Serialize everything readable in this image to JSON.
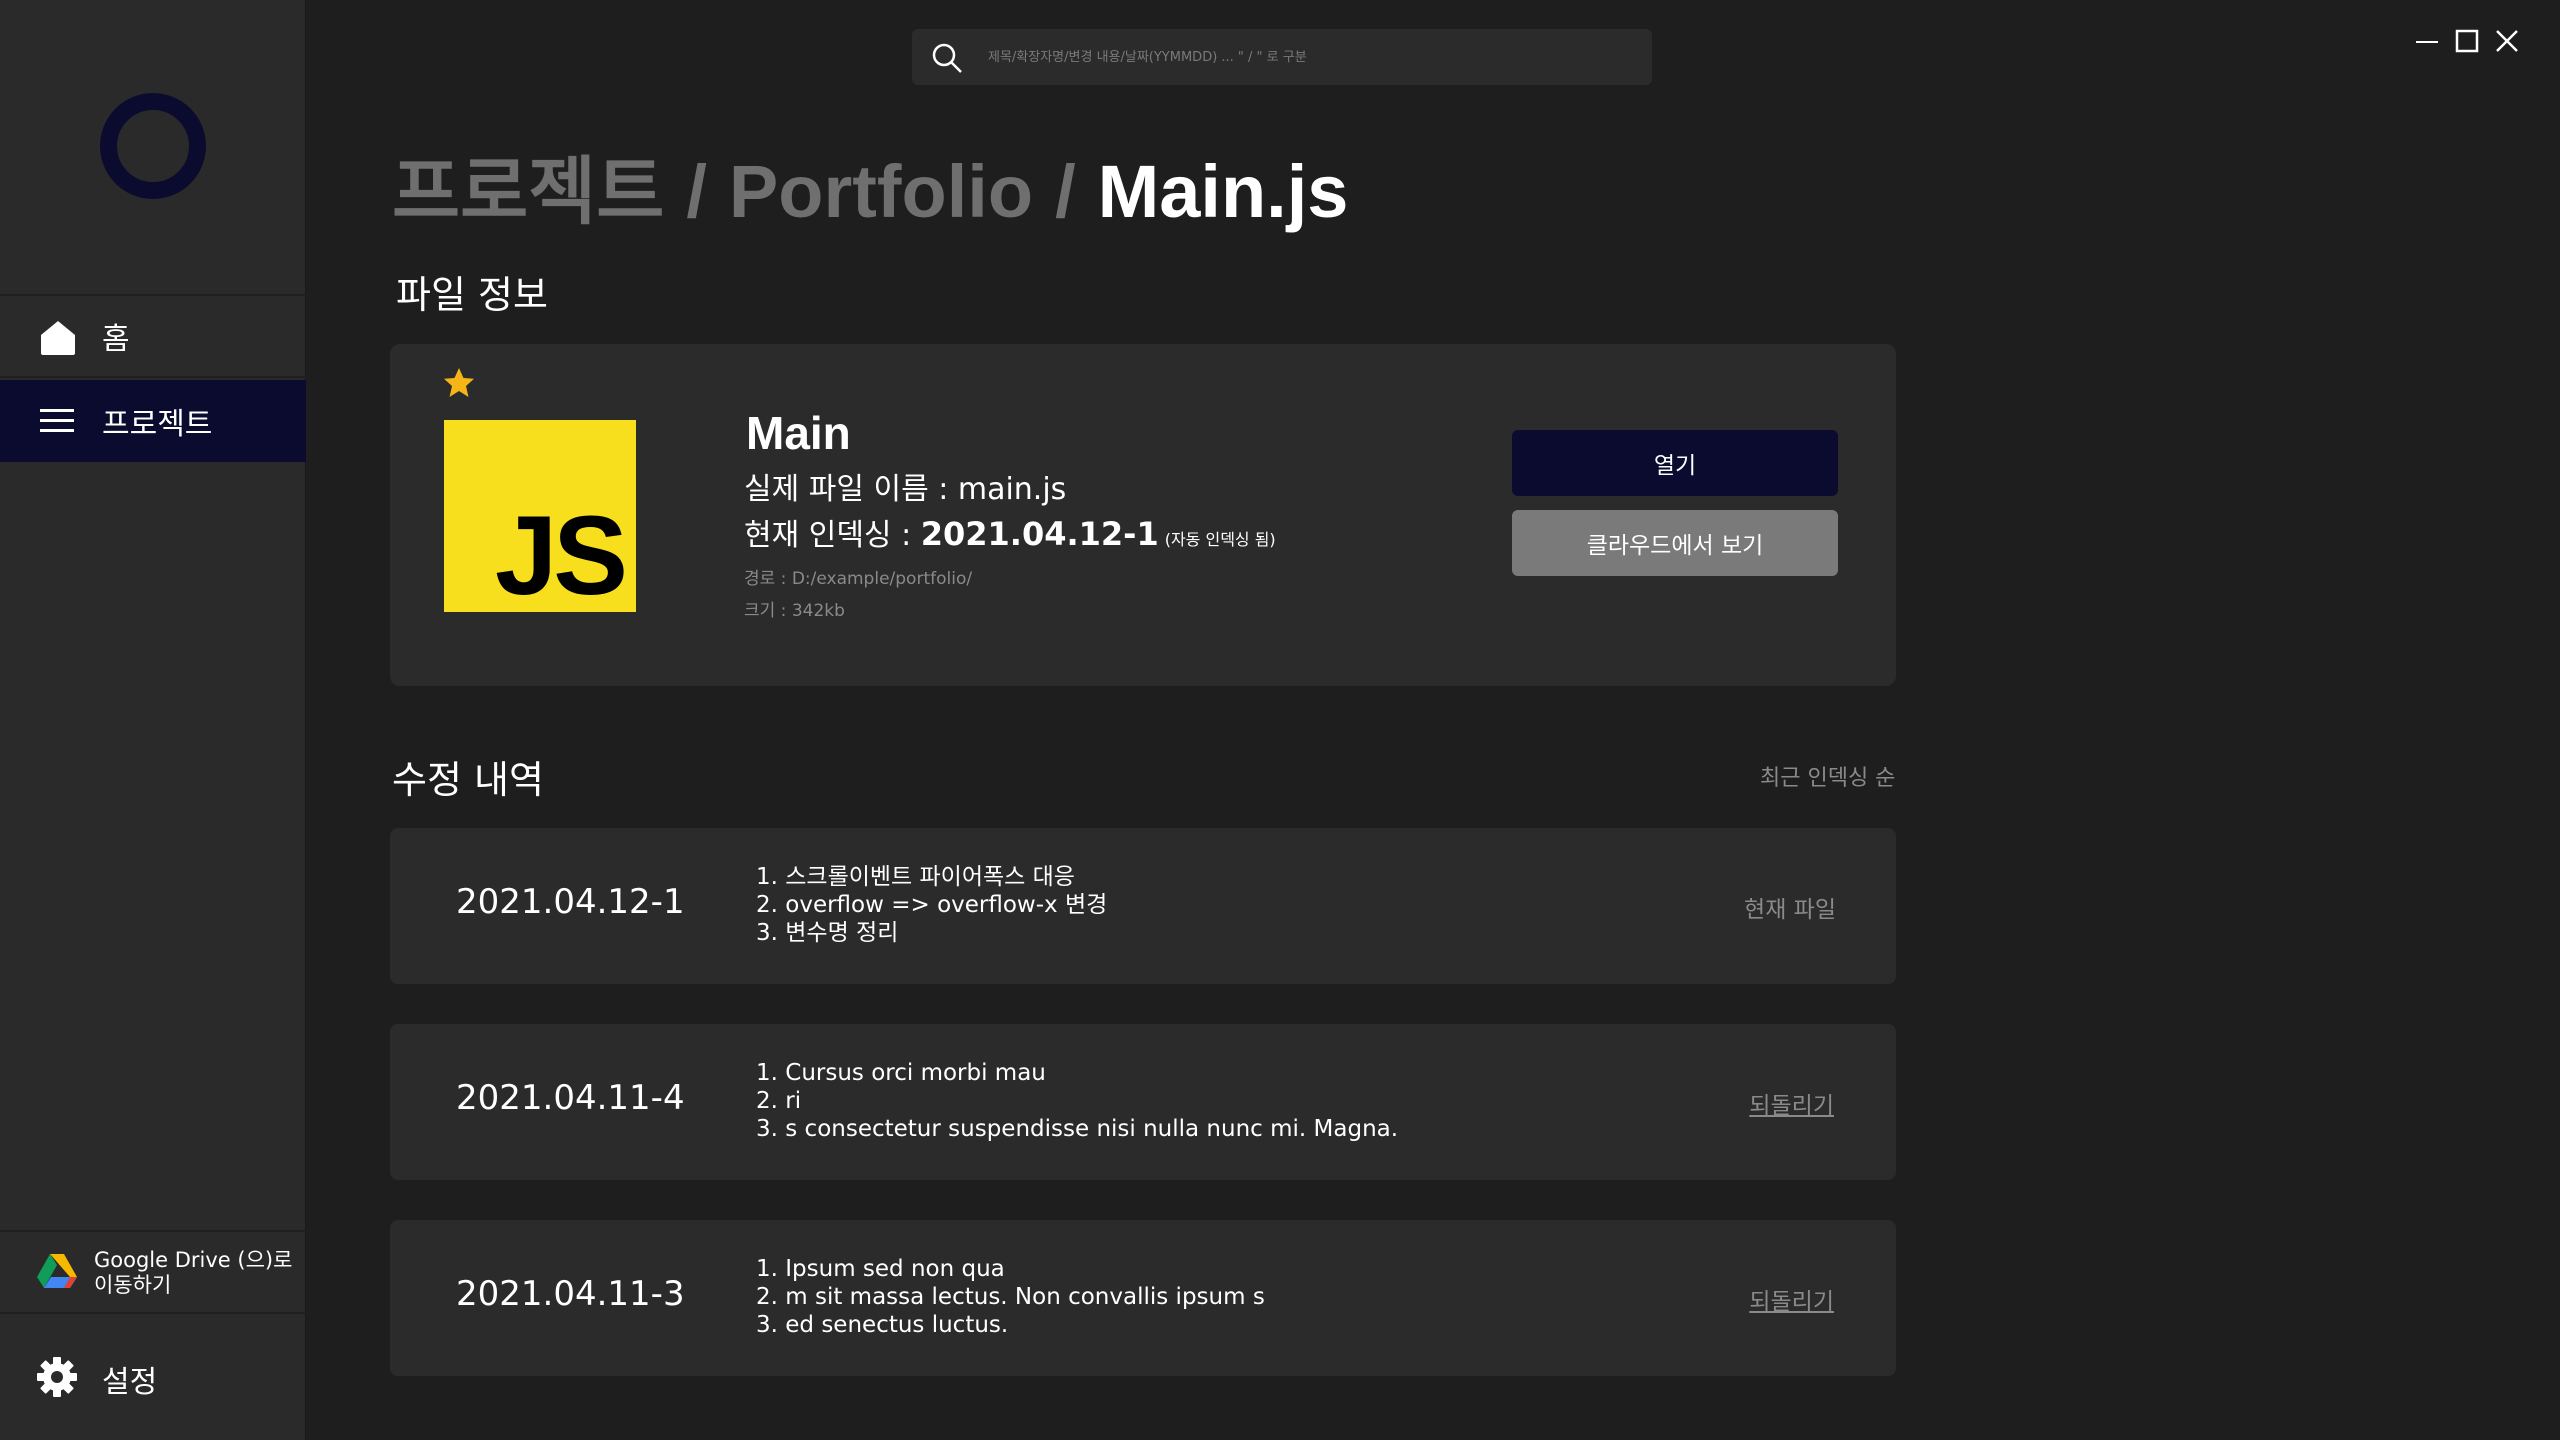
{
  "sidebar": {
    "logo": "ring-logo",
    "items": [
      {
        "label": "홈",
        "icon": "home-icon"
      },
      {
        "label": "프로젝트",
        "icon": "menu-icon",
        "active": true
      }
    ],
    "drive": {
      "label": "Google Drive (으)로 이동하기",
      "icon": "google-drive-icon"
    },
    "settings": {
      "label": "설정",
      "icon": "gear-icon"
    }
  },
  "search": {
    "placeholder": "제목/확장자명/변경 내용/날짜(YYMMDD) ... \" / \" 로 구분"
  },
  "breadcrumb": {
    "segments": [
      "프로젝트",
      "Portfolio"
    ],
    "separator": "/",
    "current": "Main.js"
  },
  "file_info": {
    "section_title": "파일 정보",
    "starred": true,
    "file_type": "JS",
    "name": "Main",
    "real_name": "실제 파일 이름 : main.js",
    "indexing_label": "현재 인덱싱 : ",
    "indexing_value": "2021.04.12-1",
    "indexing_note": "(자동 인덱싱 됨)",
    "path": "경로 : D:/example/portfolio/",
    "size": "크기 : 342kb",
    "open_button": "열기",
    "cloud_button": "클라우드에서 보기"
  },
  "history": {
    "section_title": "수정 내역",
    "sort_label": "최근 인덱싱 순",
    "rows": [
      {
        "date": "2021.04.12-1",
        "notes": [
          "1. 스크롤이벤트 파이어폭스 대응",
          "2. overflow => overflow-x 변경",
          "3. 변수명 정리"
        ],
        "action": "현재 파일"
      },
      {
        "date": "2021.04.11-4",
        "notes": [
          "1. Cursus orci morbi mau",
          "2. ri",
          "3. s consectetur suspendisse nisi nulla nunc mi. Magna."
        ],
        "action": "되돌리기"
      },
      {
        "date": "2021.04.11-3",
        "notes": [
          "1. Ipsum sed non qua",
          "2. m sit massa lectus. Non convallis ipsum s",
          "3. ed senectus luctus."
        ],
        "action": "되돌리기"
      }
    ]
  },
  "colors": {
    "background": "#1e1e1e",
    "sidebar": "#2a2a2a",
    "card": "#2b2b2b",
    "accent_navy": "#0b0b30",
    "star": "#f5b517",
    "js_yellow": "#f7df1e",
    "muted_text": "#8a8a8a"
  }
}
